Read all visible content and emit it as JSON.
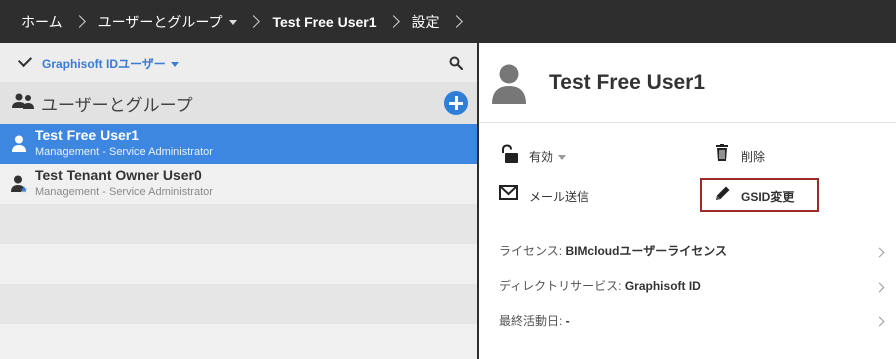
{
  "breadcrumb": {
    "home": "ホーム",
    "users_groups": "ユーザーとグループ",
    "current_user": "Test Free User1",
    "settings": "設定"
  },
  "left_panel": {
    "filter_label": "Graphisoft IDユーザー",
    "section_title": "ユーザーとグループ",
    "rows": [
      {
        "name": "Test Free User1",
        "role": "Management - Service Administrator",
        "selected": true
      },
      {
        "name": "Test Tenant Owner User0",
        "role": "Management - Service Administrator",
        "selected": false
      }
    ]
  },
  "detail": {
    "title": "Test Free User1",
    "actions": {
      "status": "有効",
      "delete": "削除",
      "send_mail": "メール送信",
      "change_gsid": "GSID変更"
    },
    "info": {
      "license_label": "ライセンス: ",
      "license_value": "BIMcloudユーザーライセンス",
      "directory_label": "ディレクトリサービス: ",
      "directory_value": "Graphisoft ID",
      "last_activity_label": "最終活動日: ",
      "last_activity_value": "-"
    }
  },
  "colors": {
    "topbar": "#2e2e2e",
    "selected_row": "#3d87e0",
    "accent_blue": "#3a7bd5",
    "highlight_border": "#a02a2a"
  },
  "icons": [
    "search-icon",
    "group-icon",
    "add-icon",
    "user-icon",
    "admin-user-icon",
    "avatar-icon",
    "unlock-icon",
    "trash-icon",
    "mail-icon",
    "pencil-icon",
    "chevron-right-icon"
  ]
}
